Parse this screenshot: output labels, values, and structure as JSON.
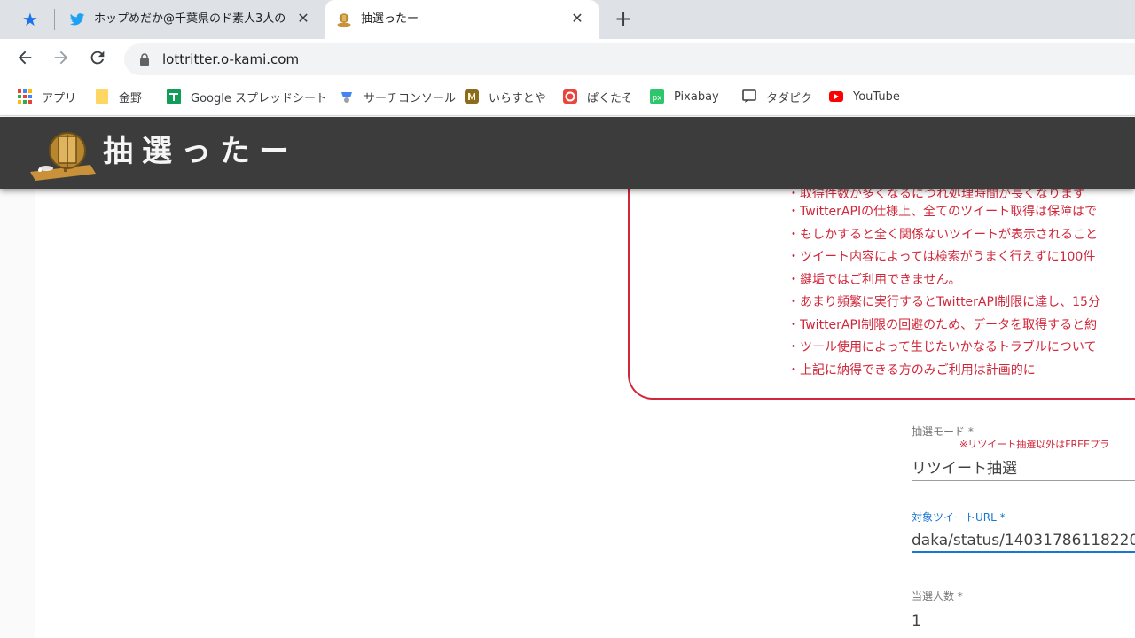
{
  "browser": {
    "tabs": [
      {
        "title": "ホップめだか@千葉県のド素人3人の",
        "active": false,
        "favicon": "twitter-bird-icon"
      },
      {
        "title": "抽選ったー",
        "active": true,
        "favicon": "lottery-drum-icon"
      }
    ],
    "new_tab_label": "+",
    "close_glyph": "✕",
    "url": "lottritter.o-kami.com",
    "bookmarks": [
      {
        "label": "アプリ",
        "icon": "apps-grid-icon"
      },
      {
        "label": "金野",
        "icon": "folder-icon"
      },
      {
        "label": "Google スプレッドシート",
        "icon": "google-sheets-icon"
      },
      {
        "label": "サーチコンソール",
        "icon": "search-console-icon"
      },
      {
        "label": "いらすとや",
        "icon": "irasutoya-icon"
      },
      {
        "label": "ぱくたそ",
        "icon": "pakutaso-icon"
      },
      {
        "label": "Pixabay",
        "icon": "pixabay-icon"
      },
      {
        "label": "タダピク",
        "icon": "tadapiku-icon"
      },
      {
        "label": "YouTube",
        "icon": "youtube-icon"
      }
    ]
  },
  "site": {
    "title": "抽選ったー"
  },
  "notice": {
    "items": [
      "・取得件数が多くなるにつれ処理時間が長くなります",
      "・TwitterAPIの仕様上、全てのツイート取得は保障はで",
      "・もしかすると全く関係ないツイートが表示されること",
      "・ツイート内容によっては検索がうまく行えずに100件",
      "・鍵垢ではご利用できません。",
      "・あまり頻繁に実行するとTwitterAPI制限に達し、15分",
      "・TwitterAPI制限の回避のため、データを取得すると約",
      "・ツール使用によって生じたいかなるトラブルについて",
      "・上記に納得できる方のみご利用は計画的に"
    ]
  },
  "form": {
    "mode": {
      "label": "抽選モード *",
      "note": "※リツイート抽選以外はFREEプラ",
      "value": "リツイート抽選"
    },
    "tweet_url": {
      "label": "対象ツイートURL *",
      "value": "daka/status/14031786118220"
    },
    "winners": {
      "label": "当選人数 *",
      "value": "1"
    }
  },
  "colors": {
    "notice_red": "#d0273a",
    "header_bg": "#3c3c3c",
    "focus_blue": "#1976d2"
  }
}
